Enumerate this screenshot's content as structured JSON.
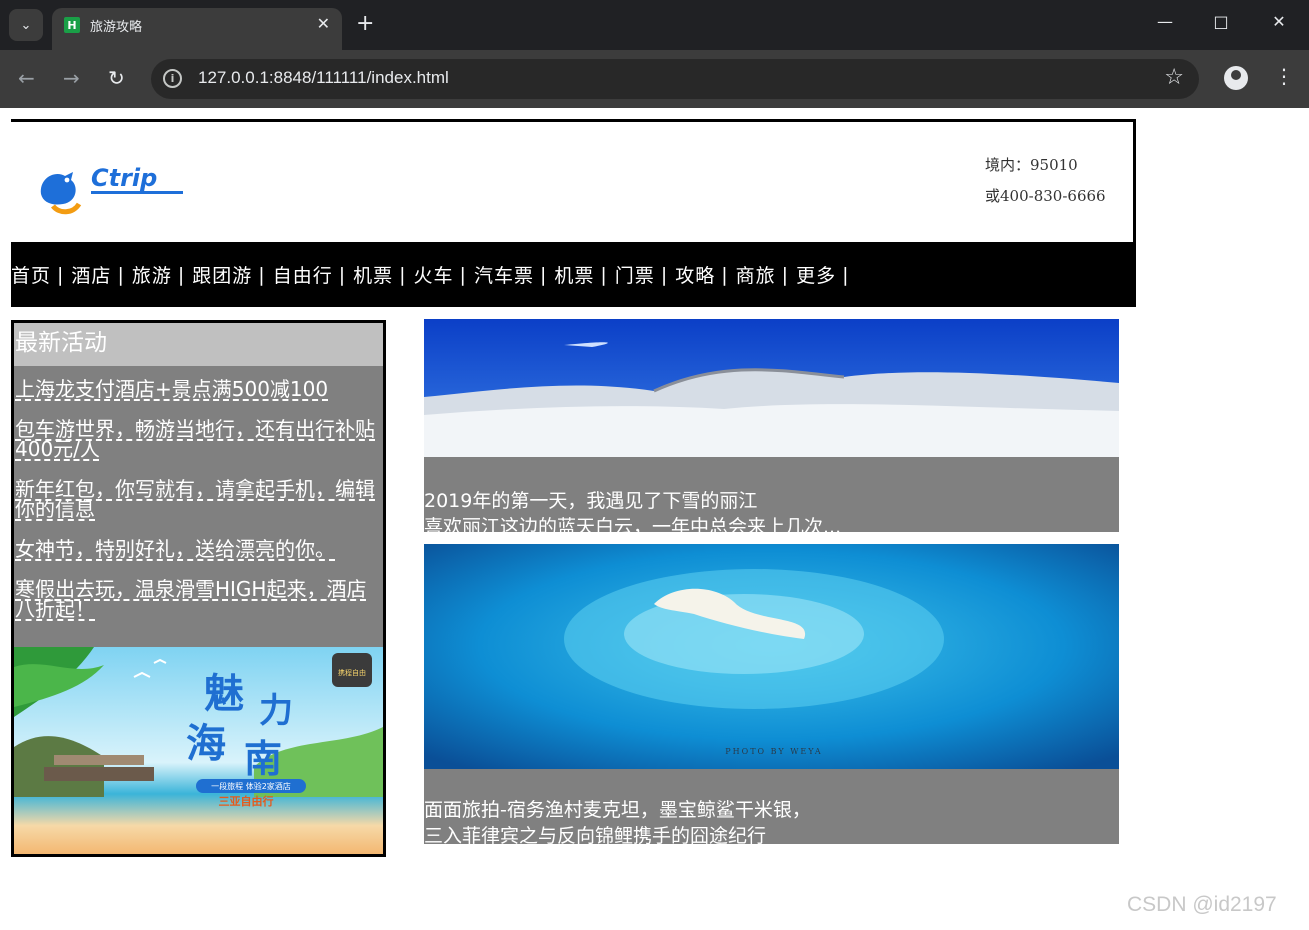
{
  "browser": {
    "tab_title": "旅游攻略",
    "tab_favicon": "H",
    "url": "127.0.0.1:8848/111111/index.html"
  },
  "header": {
    "logo_text": "Ctrip",
    "contact_line1": "境内：95010",
    "contact_line2": "或400-830-6666"
  },
  "nav": {
    "items": [
      "首页",
      "酒店",
      "旅游",
      "跟团游",
      "自由行",
      "机票",
      "火车",
      "汽车票",
      "机票",
      "门票",
      "攻略",
      "商旅",
      "更多"
    ],
    "separator": "|"
  },
  "sidebar": {
    "title": "最新活动",
    "items": [
      "上海龙支付酒店+景点满500减100",
      "包车游世界，畅游当地行，还有出行补贴400元/人",
      "新年红包，你写就有，请拿起手机，编辑你的信息",
      "女神节，特别好礼，送给漂亮的你。",
      "寒假出去玩，温泉滑雪HIGH起来，酒店八折起！"
    ],
    "ad": {
      "title_chars": [
        "魅",
        "力",
        "海",
        "南"
      ],
      "badge": "携程自由",
      "sub1": "一段旅程 体验2家酒店",
      "sub2": "三亚自由行"
    }
  },
  "articles": [
    {
      "line1": "2019年的第一天，我遇见了下雪的丽江",
      "line2": "喜欢丽江这边的蓝天白云，一年中总会来上几次..."
    },
    {
      "line1": "面面旅拍-宿务渔村麦克坦，墨宝鲸鲨干米银，",
      "line2": "三入菲律宾之与反向锦鲤携手的囧途纪行",
      "photo_credit": "PHOTO BY WEYA"
    }
  ],
  "watermark": "CSDN @id2197"
}
